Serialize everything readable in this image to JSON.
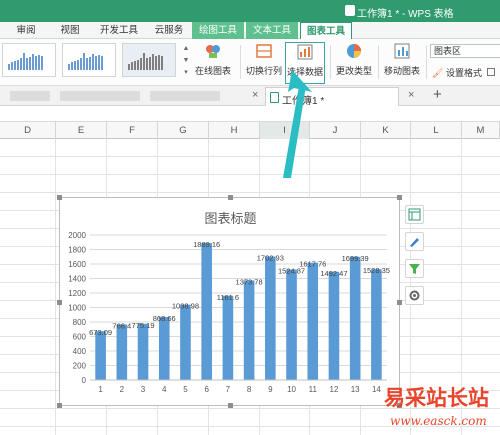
{
  "titlebar": {
    "title": "工作簿1 * - WPS 表格"
  },
  "tabs": [
    {
      "label": "审阅"
    },
    {
      "label": "视图"
    },
    {
      "label": "开发工具"
    },
    {
      "label": "云服务"
    },
    {
      "label": "绘图工具"
    },
    {
      "label": "文本工具"
    },
    {
      "label": "图表工具"
    }
  ],
  "ribbon": {
    "online_chart": "在线图表",
    "switch_row_col": "切换行列",
    "select_data": "选择数据",
    "change_type": "更改类型",
    "move_chart": "移动图表",
    "chart_area": "图表区",
    "format": "设置格式"
  },
  "doc": {
    "name": "工作簿1 *"
  },
  "columns": [
    "D",
    "E",
    "F",
    "G",
    "H",
    "I",
    "J",
    "K",
    "L",
    "M"
  ],
  "colors": {
    "accent": "#2f9b6f",
    "bar": "#5b9bd5",
    "arrow": "#2bbdc4",
    "watermark": "#e8452c"
  },
  "chart_data": {
    "type": "bar",
    "title": "图表标题",
    "categories": [
      "1",
      "2",
      "3",
      "4",
      "5",
      "6",
      "7",
      "8",
      "9",
      "10",
      "11",
      "12",
      "13",
      "14"
    ],
    "values": [
      673.09,
      766.4,
      775.19,
      868.66,
      1038.98,
      1889.16,
      1161.6,
      1373.78,
      1702.93,
      1524.87,
      1617.76,
      1492.47,
      1699.39,
      1528.35
    ],
    "data_labels": [
      "673.09",
      "766.4",
      "775.19",
      "868.66",
      "1038.98",
      "1889.16",
      "1161.6",
      "1373.78",
      "1702.93",
      "1524.87",
      "1617.76",
      "1492.47",
      "1699.39",
      "1528.35"
    ],
    "y_ticks": [
      "0",
      "200",
      "400",
      "600",
      "800",
      "1000",
      "1200",
      "1400",
      "1600",
      "1800",
      "2000"
    ],
    "ylim": [
      0,
      2000
    ],
    "grid": true,
    "legend": "none"
  },
  "watermark": {
    "text": "易采站长站",
    "url": "www.easck.com"
  }
}
